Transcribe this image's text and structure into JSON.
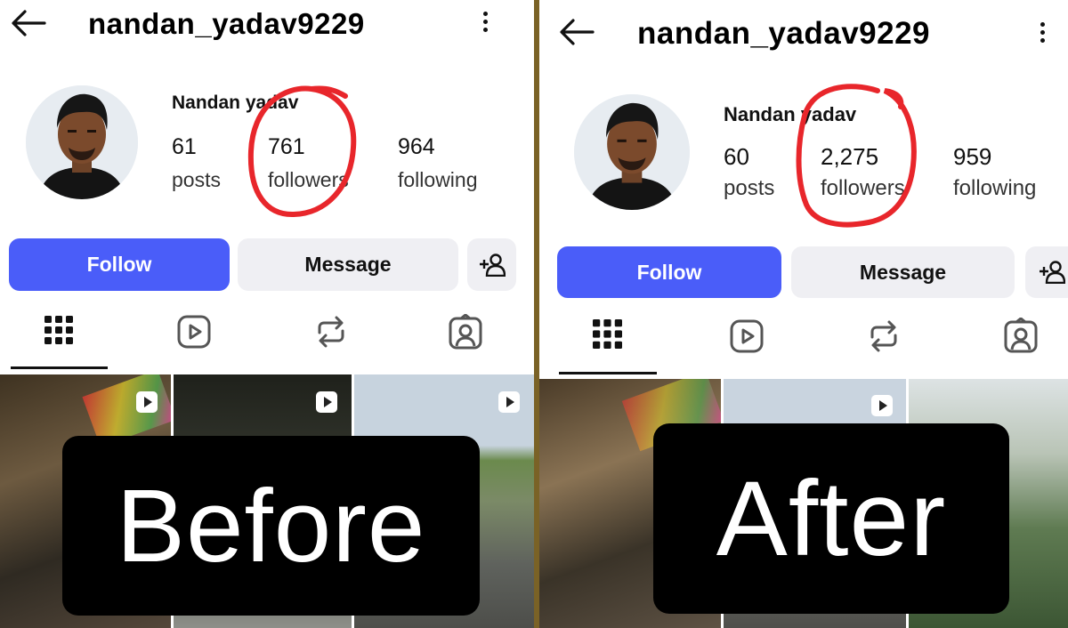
{
  "before": {
    "username": "nandan_yadav9229",
    "full_name": "Nandan yadav",
    "stats": {
      "posts": "61",
      "posts_label": "posts",
      "followers": "761",
      "followers_label": "followers",
      "following": "964",
      "following_label": "following"
    },
    "buttons": {
      "follow": "Follow",
      "message": "Message"
    },
    "caption": "Before"
  },
  "after": {
    "username": "nandan_yadav9229",
    "full_name": "Nandan yadav",
    "stats": {
      "posts": "60",
      "posts_label": "posts",
      "followers": "2,275",
      "followers_label": "followers",
      "following": "959",
      "following_label": "following"
    },
    "buttons": {
      "follow": "Follow",
      "message": "Message"
    },
    "caption": "After"
  },
  "icons": [
    "back-arrow-icon",
    "more-options-icon",
    "add-person-icon",
    "grid-icon",
    "reels-icon",
    "reposts-icon",
    "tagged-icon",
    "reel-play-icon"
  ],
  "colors": {
    "follow_button": "#4a5df9",
    "secondary_button": "#efeff3",
    "highlight_circle": "#e8262b",
    "divider": "#7a6226",
    "caption_background": "#000000"
  }
}
